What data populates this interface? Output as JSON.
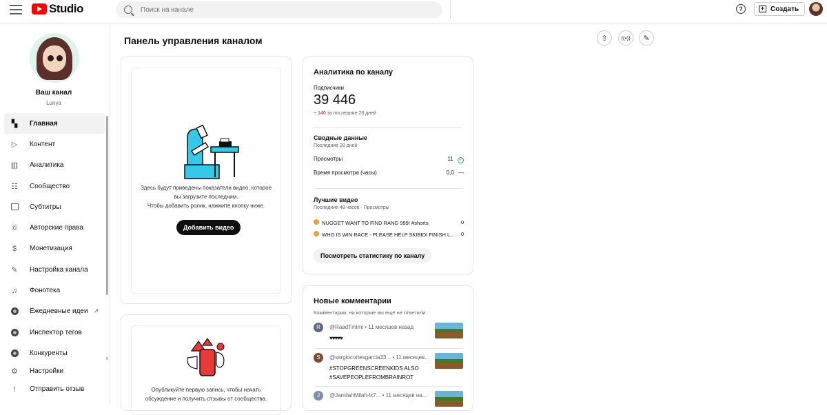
{
  "topbar": {
    "logo_text": "Studio",
    "search_placeholder": "Поиск на канале",
    "help_glyph": "?",
    "create_label": "Создать"
  },
  "sidebar": {
    "channel_name": "Ваш канал",
    "channel_handle": "Lunya",
    "items": [
      {
        "label": "Главная",
        "icon": "dashboard-icon",
        "active": true
      },
      {
        "label": "Контент",
        "icon": "content-icon"
      },
      {
        "label": "Аналитика",
        "icon": "analytics-icon"
      },
      {
        "label": "Сообщество",
        "icon": "community-icon"
      },
      {
        "label": "Субтитры",
        "icon": "subtitles-icon"
      },
      {
        "label": "Авторские права",
        "icon": "copyright-icon"
      },
      {
        "label": "Монетизация",
        "icon": "monetization-icon"
      },
      {
        "label": "Настройка канала",
        "icon": "customization-icon"
      },
      {
        "label": "Фонотека",
        "icon": "audio-library-icon"
      },
      {
        "label": "Ежедневные идеи",
        "icon": "extension-icon",
        "external": true
      },
      {
        "label": "Инспектор тегов",
        "icon": "extension-icon"
      },
      {
        "label": "Конкуренты",
        "icon": "extension-icon"
      },
      {
        "label": "Настройки",
        "icon": "settings-icon"
      },
      {
        "label": "Отправить отзыв",
        "icon": "feedback-icon"
      }
    ]
  },
  "main": {
    "title": "Панель управления каналом",
    "upload_card": {
      "text_line1": "Здесь будут приведены показатели видео, которое",
      "text_line2": "вы загрузите последним.",
      "text_line3": "Чтобы добавить ролик, нажмите кнопку ниже.",
      "button": "Добавить видео"
    },
    "post_card": {
      "text_line1": "Опубликуйте первую запись, чтобы начать",
      "text_line2": "обсуждение и получить отзывы от сообщества."
    },
    "analytics": {
      "title": "Аналитика по каналу",
      "subs_label": "Подписчики",
      "subs_value": "39 446",
      "subs_delta": "− 140",
      "subs_delta_period": "за последние 28 дней",
      "summary_title": "Сводные данные",
      "summary_period": "Последние 28 дней",
      "views_label": "Просмотры",
      "views_value": "11",
      "watch_label": "Время просмотра (часы)",
      "watch_value": "0,0",
      "watch_trend": "—",
      "top_title": "Лучшие видео",
      "top_period": "Последние 48 часов · Просмотры",
      "videos": [
        {
          "title": "NUGGET WANT TO FIND RANG 999! #shorts",
          "views": "0"
        },
        {
          "title": "WHO IS WIN RACE - PLEASE HELP SKIBIDI FINISH L...",
          "views": "0"
        }
      ],
      "button": "Посмотреть статистику по каналу"
    },
    "comments": {
      "title": "Новые комментарии",
      "subtitle": "Комментарии, на которые вы ещё не ответили",
      "items": [
        {
          "initial": "R",
          "author": "@RaadTmimi • 11 месяцев назад",
          "text": "♥♥♥♥♥",
          "color": "#5f6b7a"
        },
        {
          "initial": "S",
          "author": "@sergiocortesgarcia33... • 11 месяцев...",
          "text": "#STOPGREENSCREENKIDS ALSO #SAVEPEOPLEFROMBRAINROT",
          "color": "#7a4a3a"
        },
        {
          "initial": "J",
          "author": "@JamilahMilah-lx7... • 11 месяцев на...",
          "text": "",
          "color": "#7d8fa8"
        }
      ]
    }
  },
  "colors": {
    "brand_red": "#ff0000",
    "accent_cyan": "#35c9e8",
    "negative": "#cc0000",
    "positive": "#2ba640"
  }
}
